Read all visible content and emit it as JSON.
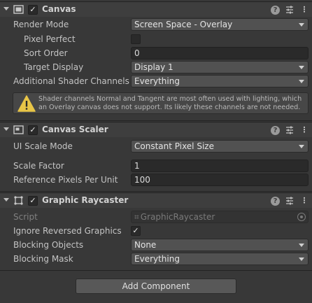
{
  "canvas": {
    "title": "Canvas",
    "enabled": "✓",
    "icons": {
      "component": "canvas-icon",
      "help": "help-icon",
      "presets": "presets-icon",
      "menu": "context-menu-icon"
    },
    "help_glyph": "?",
    "menu_glyph": "⋮",
    "render_mode_label": "Render Mode",
    "render_mode_value": "Screen Space - Overlay",
    "pixel_perfect_label": "Pixel Perfect",
    "sort_order_label": "Sort Order",
    "sort_order_value": "0",
    "target_display_label": "Target Display",
    "target_display_value": "Display 1",
    "shader_channels_label": "Additional Shader Channels",
    "shader_channels_value": "Everything",
    "warning": "Shader channels Normal and Tangent are most often used with lighting, which an Overlay canvas does not support. Its likely these channels are not needed."
  },
  "scaler": {
    "title": "Canvas Scaler",
    "enabled": "✓",
    "help_glyph": "?",
    "menu_glyph": "⋮",
    "ui_scale_mode_label": "UI Scale Mode",
    "ui_scale_mode_value": "Constant Pixel Size",
    "scale_factor_label": "Scale Factor",
    "scale_factor_value": "1",
    "ref_ppu_label": "Reference Pixels Per Unit",
    "ref_ppu_value": "100"
  },
  "raycaster": {
    "title": "Graphic Raycaster",
    "enabled": "✓",
    "help_glyph": "?",
    "menu_glyph": "⋮",
    "script_label": "Script",
    "script_value": "GraphicRaycaster",
    "ignore_reversed_label": "Ignore Reversed Graphics",
    "ignore_reversed_check": "✓",
    "blocking_objects_label": "Blocking Objects",
    "blocking_objects_value": "None",
    "blocking_mask_label": "Blocking Mask",
    "blocking_mask_value": "Everything"
  },
  "add_component_label": "Add Component",
  "colors": {
    "background": "#383838",
    "header": "#3e3e3e",
    "dropdown": "#515151",
    "field": "#2a2a2a",
    "warning": "#e8c547"
  }
}
